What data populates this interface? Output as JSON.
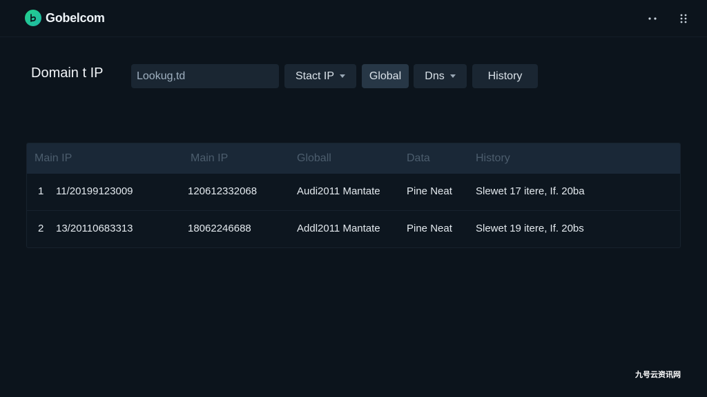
{
  "app": {
    "brand": "Gobelcom"
  },
  "header": {
    "title": "Domain t IP"
  },
  "search": {
    "value": "Lookug,td"
  },
  "toolbar": {
    "static_ip": "Stact IP",
    "global": "Global",
    "dns": "Dns",
    "history": "History"
  },
  "table": {
    "columns": [
      "Main IP",
      "Main IP",
      "Globall",
      "Data",
      "History"
    ],
    "rows": [
      {
        "index": "1",
        "main_ip": "11/20199123009",
        "main_ip_2": "120612332068",
        "global": "Audi2011 Mantate",
        "data": "Pine Neat",
        "history": "Slewet 17 itere, If. 20ba"
      },
      {
        "index": "2",
        "main_ip": "13/20110683313",
        "main_ip_2": "18062246688",
        "global": "Addl2011 Mantate",
        "data": "Pine Neat",
        "history": "Slewet 19 itere, If. 20bs"
      }
    ]
  },
  "watermark": "九号云资讯网",
  "colors": {
    "accent": "#23d18b",
    "background": "#0c141c",
    "header_row": "#1a2837"
  },
  "icons": {
    "brand": "logo-icon",
    "menu": "more-horizontal-icon",
    "grid": "grid-dots-icon"
  }
}
